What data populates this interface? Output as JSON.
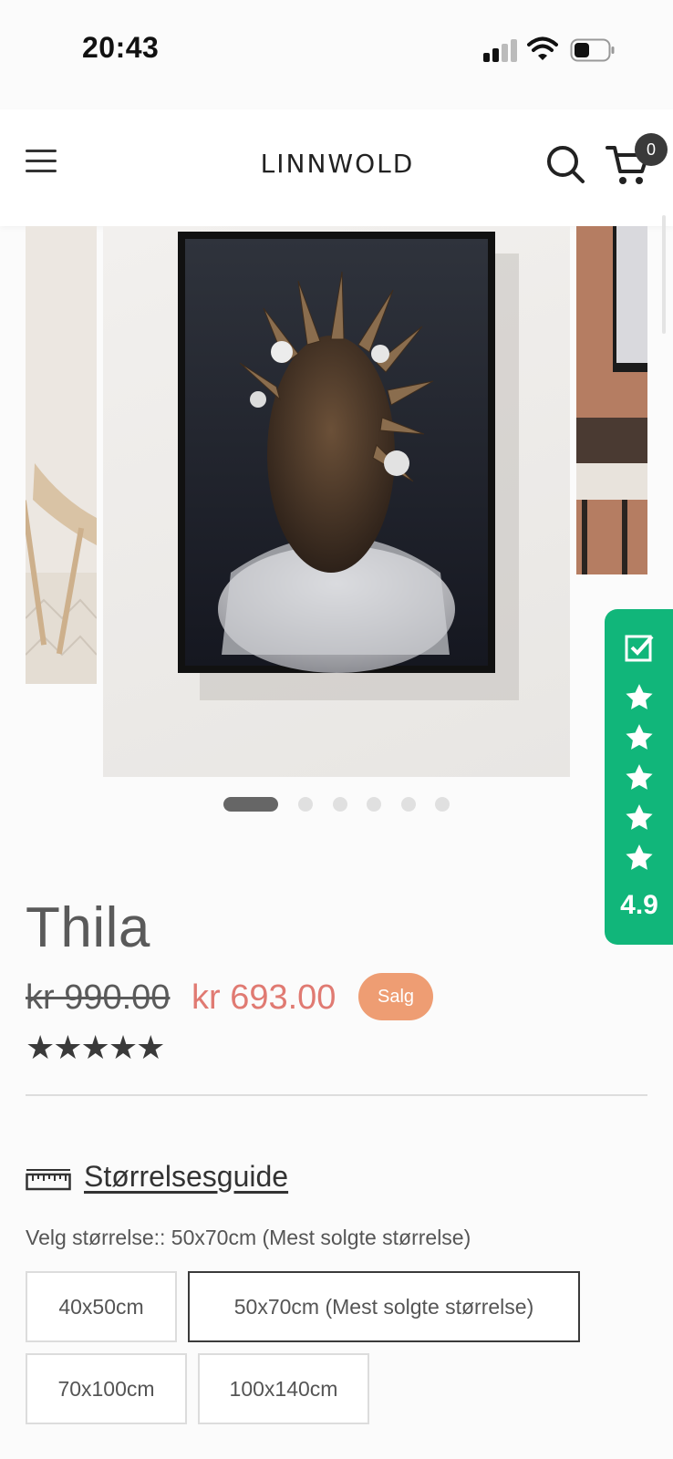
{
  "status_bar": {
    "time": "20:43"
  },
  "header": {
    "logo_text": "LINNWOLD",
    "cart_count": "0"
  },
  "gallery": {
    "slide_count": 6,
    "active_index": 0
  },
  "reviews_widget": {
    "rating": "4.9",
    "stars": 5,
    "color": "#11b67a"
  },
  "product": {
    "title": "Thila",
    "price_old": "kr 990.00",
    "price_new": "kr 693.00",
    "sale_badge": "Salg",
    "stars_text": "★★★★★",
    "size_guide_label": "Størrelsesguide",
    "size_label": "Velg størrelse:: 50x70cm (Mest solgte størrelse)",
    "sizes": [
      {
        "label": "40x50cm",
        "selected": false
      },
      {
        "label": "50x70cm (Mest solgte størrelse)",
        "selected": true
      },
      {
        "label": "70x100cm",
        "selected": false
      },
      {
        "label": "100x140cm",
        "selected": false
      }
    ]
  },
  "colors": {
    "sale_price": "#e07a72",
    "sale_badge": "#ee9d73",
    "text": "#5a5a5a"
  }
}
